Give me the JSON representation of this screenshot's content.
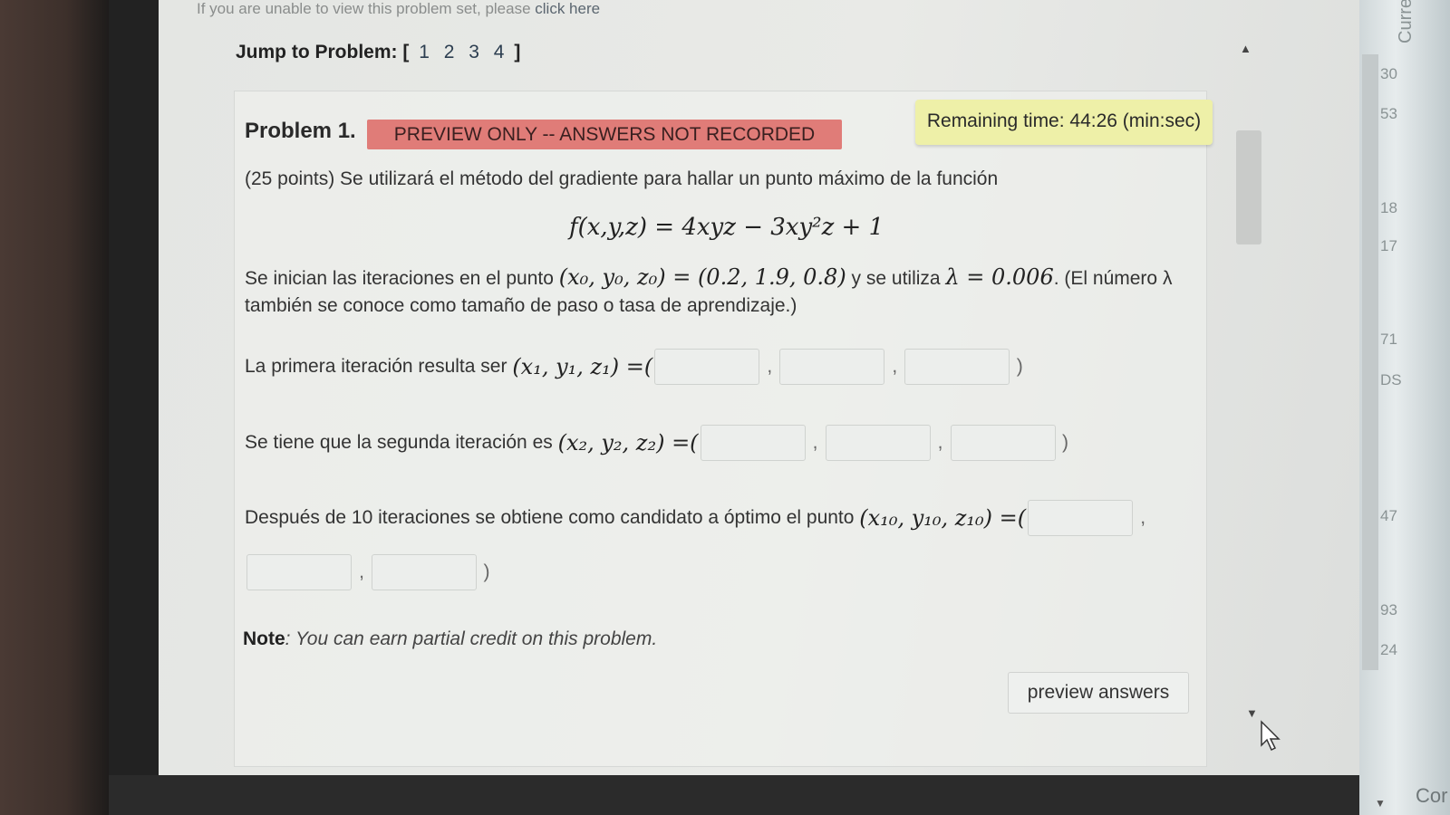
{
  "top_note": {
    "text": "If you are unable to view this problem set, please ",
    "link": "click here"
  },
  "jump": {
    "label": "Jump to Problem: [",
    "problems": [
      "1",
      "2",
      "3",
      "4"
    ],
    "close": "]"
  },
  "problem": {
    "title": "Problem 1.",
    "badge": "PREVIEW ONLY -- ANSWERS NOT RECORDED",
    "timer": "Remaining time: 44:26 (min:sec)",
    "intro": "(25 points) Se utilizará el método del gradiente para hallar un punto máximo de la función",
    "formula": "f(x,y,z) = 4xyz − 3xy²z + 1",
    "start_text_1": "Se inician las iteraciones en el punto",
    "start_point": "(x₀, y₀, z₀) = (0.2, 1.9, 0.8)",
    "start_text_2": "y se utiliza",
    "lambda_eq": "λ = 0.006",
    "start_text_3": ". (El número λ",
    "start_text_4": "también se conoce como tamaño de paso o tasa de aprendizaje.)",
    "q1_text": "La primera iteración resulta ser",
    "q1_math": "(x₁, y₁, z₁) =(",
    "q2_text": "Se tiene que la segunda iteración es",
    "q2_math": "(x₂, y₂, z₂) =(",
    "q3_text": "Después de 10 iteraciones se obtiene como candidato a óptimo el punto",
    "q3_math": "(x₁₀, y₁₀, z₁₀) =(",
    "close_paren": ")",
    "comma": ",",
    "note_label": "Note",
    "note_text": ": You can earn partial credit on this problem.",
    "preview_button": "preview answers"
  },
  "side": {
    "vertical": "Curre",
    "bottom": "Cor",
    "labels": [
      "30",
      "53",
      "18",
      "17",
      "71",
      "DS",
      "47",
      "93",
      "24"
    ]
  },
  "colors": {
    "badge": "#e07c78",
    "timer_bg": "#eef0a8",
    "page_bg": "#e8e9e7"
  }
}
